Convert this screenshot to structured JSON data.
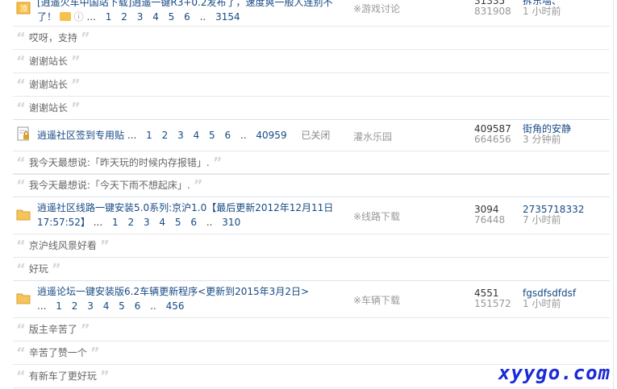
{
  "threads": [
    {
      "title": "[逍遥火车中国站下载]道道一键R3+0.2发布了，速度爽一般人连别不了！",
      "title_clip": "[逍遥火车中国站下载]逍遥一键R3+0.2发布了，速度爽一般人连别不",
      "title_line2": "了！",
      "pages": [
        "1",
        "2",
        "3",
        "4",
        "5",
        "6"
      ],
      "last_page": "3154",
      "forum": "※游戏讨论",
      "replies": "31335",
      "views": "831908",
      "last_user": "拆东墙、",
      "last_time": "1 小时前"
    },
    {
      "title": "逍遥社区签到专用贴",
      "pages": [
        "1",
        "2",
        "3",
        "4",
        "5",
        "6"
      ],
      "last_page": "40959",
      "closed": "已关闭",
      "forum": "灌水乐园",
      "replies": "409587",
      "views": "664656",
      "last_user": "街角的安静",
      "last_time": "3 分钟前"
    },
    {
      "title": "逍遥社区线路一键安装5.0系列:京沪1.0【最后更新2012年12月11日",
      "title_line2": "17:57:52】",
      "pages": [
        "1",
        "2",
        "3",
        "4",
        "5",
        "6"
      ],
      "last_page": "310",
      "forum": "※线路下载",
      "replies": "3094",
      "views": "76448",
      "last_user": "2735718332",
      "last_time": "7 小时前"
    },
    {
      "title": "逍遥论坛一键安装版6.2车辆更新程序<更新到2015年3月2日>",
      "pages": [
        "1",
        "2",
        "3",
        "4",
        "5",
        "6"
      ],
      "last_page": "456",
      "forum": "※车辆下载",
      "replies": "4551",
      "views": "151572",
      "last_user": "fgsdfsdfdsf",
      "last_time": "1 小时前"
    }
  ],
  "replies_t1": [
    "哎呀，支持",
    "谢谢站长",
    "谢谢站长",
    "谢谢站长"
  ],
  "replies_t2": [
    "我今天最想说:「昨天玩的时候内存报错」.",
    "我今天最想说:「今天下雨不想起床」."
  ],
  "replies_t3": [
    "京沪线风景好看",
    "好玩"
  ],
  "replies_t4": [
    "版主辛苦了",
    "辛苦了赞一个",
    "有新车了更好玩"
  ],
  "dots": "..",
  "lead_dots": "...",
  "watermark": "xyygo.com"
}
